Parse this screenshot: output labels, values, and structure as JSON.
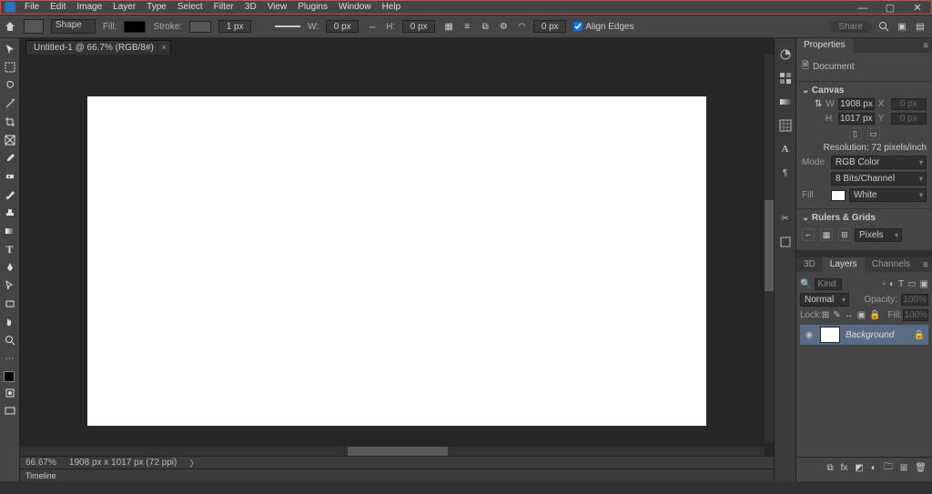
{
  "menu": {
    "items": [
      "File",
      "Edit",
      "Image",
      "Layer",
      "Type",
      "Select",
      "Filter",
      "3D",
      "View",
      "Plugins",
      "Window",
      "Help"
    ]
  },
  "window_controls": {
    "min": "—",
    "max": "▢",
    "close": "✕"
  },
  "options": {
    "tool_preset": "Shape",
    "fill_label": "Fill:",
    "stroke_label": "Stroke:",
    "stroke_width": "1 px",
    "w_label": "W:",
    "w_value": "0 px",
    "h_label": "H:",
    "h_value": "0 px",
    "gear_value": "0 px",
    "align_edges": "Align Edges",
    "share": "Share"
  },
  "doc_tab": {
    "title": "Untitled-1 @ 66.7% (RGB/8#)"
  },
  "status": {
    "zoom": "66.67%",
    "dims": "1908 px x 1017 px (72 ppi)"
  },
  "timeline": {
    "label": "Timeline"
  },
  "dock": {
    "icons": [
      "color-icon",
      "swatches-icon",
      "gradients-icon",
      "patterns-icon",
      "character-icon",
      "paragraph-icon",
      "adjustments-icon",
      "libraries-icon"
    ]
  },
  "properties": {
    "tab": "Properties",
    "doc_label": "Document",
    "canvas_section": "Canvas",
    "w_label": "W",
    "w_value": "1908 px",
    "x_label": "X",
    "x_value": "0 px",
    "h_label": "H",
    "h_value": "1017 px",
    "y_label": "Y",
    "y_value": "0 px",
    "resolution": "Resolution: 72 pixels/inch",
    "mode_label": "Mode",
    "mode_value": "RGB Color",
    "depth_value": "8 Bits/Channel",
    "fill_label": "Fill",
    "fill_value": "White",
    "rulers_section": "Rulers & Grids",
    "rulers_unit": "Pixels"
  },
  "layers": {
    "tabs": [
      "3D",
      "Layers",
      "Channels"
    ],
    "kind": "Kind",
    "blend": "Normal",
    "opacity_label": "Opacity:",
    "opacity_value": "100%",
    "lock_label": "Lock:",
    "fill_label": "Fill:",
    "fill_value": "100%",
    "layer0": "Background"
  }
}
